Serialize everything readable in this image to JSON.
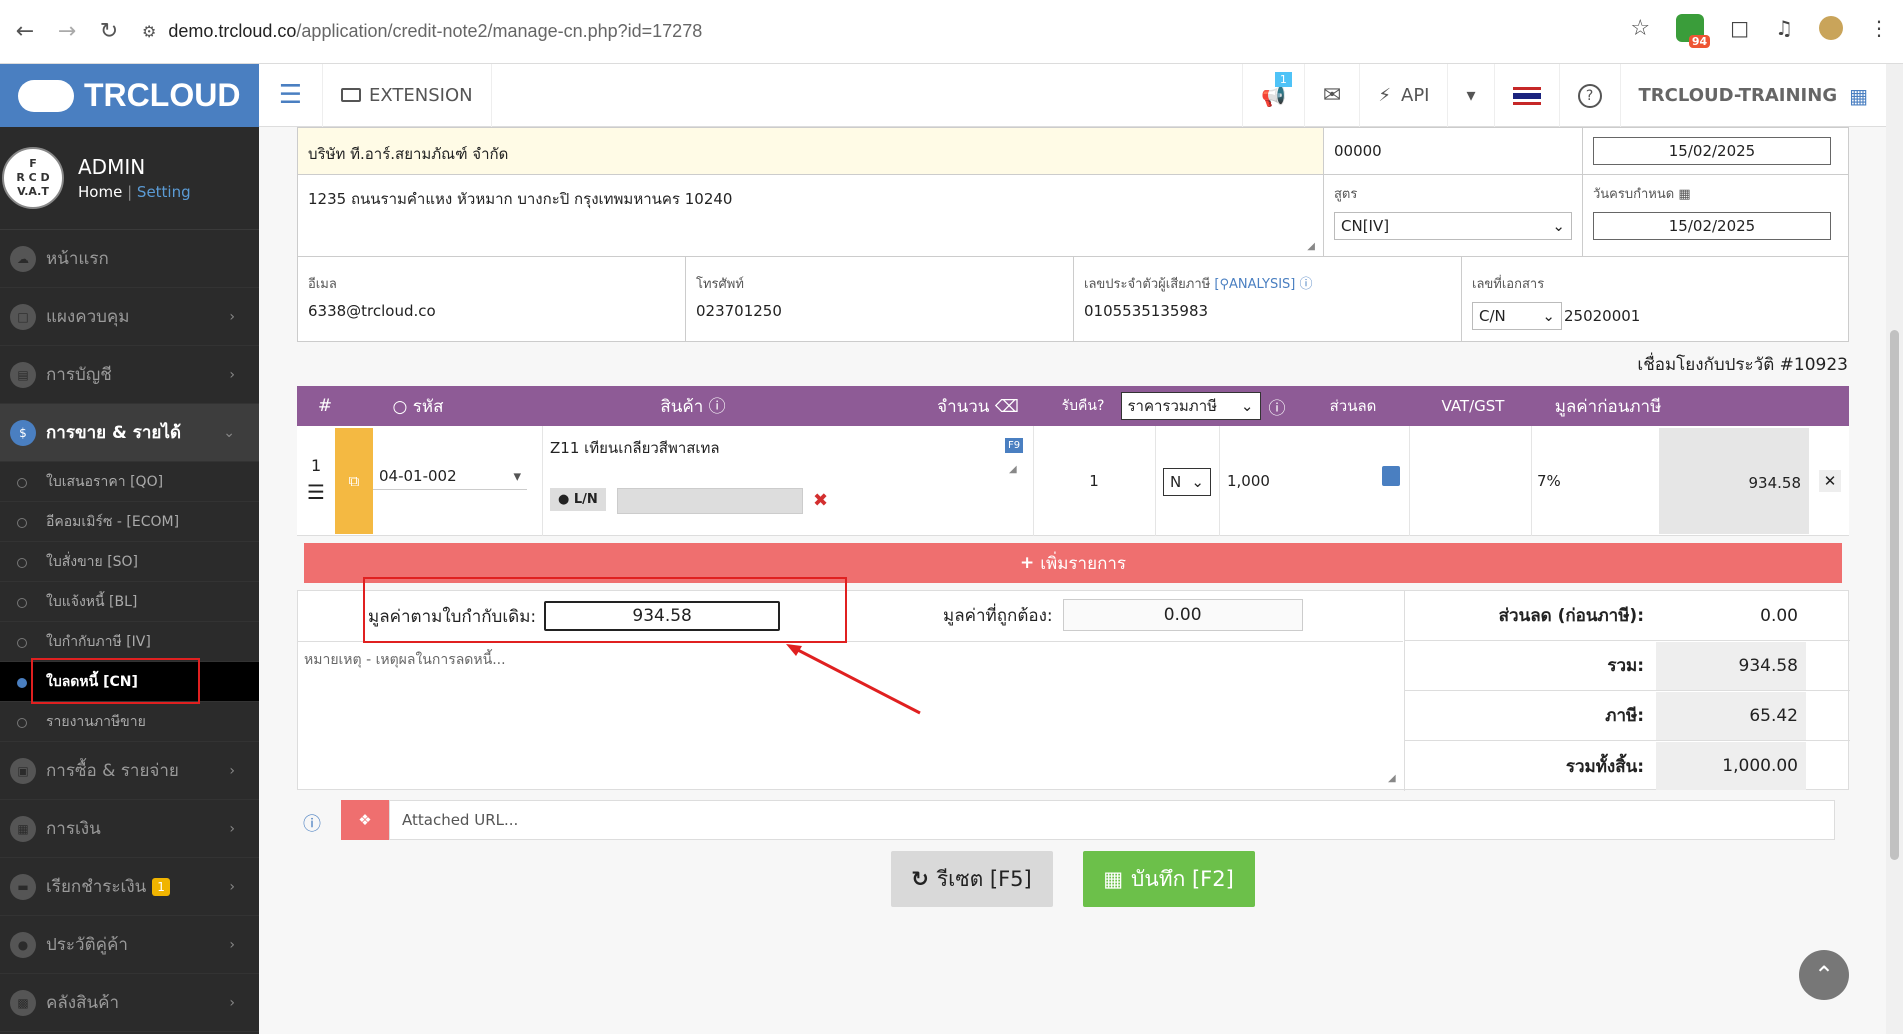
{
  "browser": {
    "url_host": "demo.trcloud.co",
    "url_path": "/application/credit-note2/manage-cn.php?id=17278",
    "ext_count": "94"
  },
  "brand": {
    "name": "TRCLOUD"
  },
  "user": {
    "name": "ADMIN",
    "home": "Home",
    "sep": "|",
    "setting": "Setting",
    "avatar_text": "F R C D V.A.T."
  },
  "sidebar": {
    "items": [
      {
        "label": "หน้าแรก"
      },
      {
        "label": "แผงควบคุม"
      },
      {
        "label": "การบัญชี"
      },
      {
        "label": "การขาย & รายได้"
      },
      {
        "label": "การซื้อ & รายจ่าย"
      },
      {
        "label": "การเงิน"
      },
      {
        "label": "เรียกชำระเงิน",
        "badge": "1"
      },
      {
        "label": "ประวัติคู่ค้า"
      },
      {
        "label": "คลังสินค้า"
      }
    ],
    "sub_items": [
      {
        "label": "ใบเสนอราคา [QO]"
      },
      {
        "label": "อีคอมเมิร์ซ - [ECOM]"
      },
      {
        "label": "ใบสั่งขาย [SO]"
      },
      {
        "label": "ใบแจ้งหนี้ [BL]"
      },
      {
        "label": "ใบกำกับภาษี [IV]"
      },
      {
        "label": "ใบลดหนี้ [CN]"
      },
      {
        "label": "รายงานภาษีขาย"
      }
    ]
  },
  "topnav": {
    "extension": "EXTENSION",
    "notif_count": "1",
    "api": "API",
    "company": "TRCLOUD-TRAINING"
  },
  "form": {
    "company_name": "บริษัท ที.อาร์.สยามภัณฑ์ จำกัด",
    "customer_code": "00000",
    "doc_date": "15/02/2025",
    "address": "1235 ถนนรามคำแหง หัวหมาก บางกะปิ กรุงเทพมหานคร 10240",
    "formula_label": "สูตร",
    "formula_value": "CN[IV]",
    "due_label": "วันครบกำหนด",
    "due_date": "15/02/2025",
    "email_label": "อีเมล",
    "email": "6338@trcloud.co",
    "phone_label": "โทรศัพท์",
    "phone": "023701250",
    "taxid_label": "เลขประจำตัวผู้เสียภาษี",
    "analysis": "ANALYSIS",
    "taxid": "0105535135983",
    "docno_label": "เลขที่เอกสาร",
    "doc_prefix": "C/N",
    "doc_number": "25020001",
    "linked": "เชื่อมโยงกับประวัติ #10923"
  },
  "items_table": {
    "headers": {
      "num": "#",
      "code": "รหัส",
      "product": "สินค้า",
      "qty": "จำนวน",
      "return": "รับคืน?",
      "price_mode": "ราคารวมภาษี",
      "discount": "ส่วนลด",
      "vat": "VAT/GST",
      "pre_tax": "มูลค่าก่อนภาษี"
    },
    "rows": [
      {
        "num": "1",
        "code": "04-01-002",
        "product": "Z11 เทียนเกลียวสีพาสเทล",
        "f9": "F9",
        "ln": "L/N",
        "qty": "1",
        "return": "N",
        "price": "1,000",
        "vat": "7%",
        "pre_tax": "934.58"
      }
    ],
    "add_label": "เพิ่มรายการ"
  },
  "summary": {
    "orig_label": "มูลค่าตามใบกำกับเดิม:",
    "orig_value": "934.58",
    "correct_label": "มูลค่าที่ถูกต้อง:",
    "correct_value": "0.00",
    "note_placeholder": "หมายเหตุ - เหตุผลในการลดหนี้...",
    "discount_label": "ส่วนลด (ก่อนภาษี):",
    "discount_value": "0.00",
    "total_label": "รวม:",
    "total_value": "934.58",
    "tax_label": "ภาษี:",
    "tax_value": "65.42",
    "grand_label": "รวมทั้งสิ้น:",
    "grand_value": "1,000.00",
    "attach_placeholder": "Attached URL..."
  },
  "buttons": {
    "reset": "รีเซต [F5]",
    "save": "บันทึก [F2]"
  },
  "colors": {
    "brand_blue": "#4a7fc1",
    "header_purple": "#8e5b96",
    "add_red": "#ef6f6f",
    "save_green": "#6cc04a",
    "highlight_red": "#e02020"
  }
}
